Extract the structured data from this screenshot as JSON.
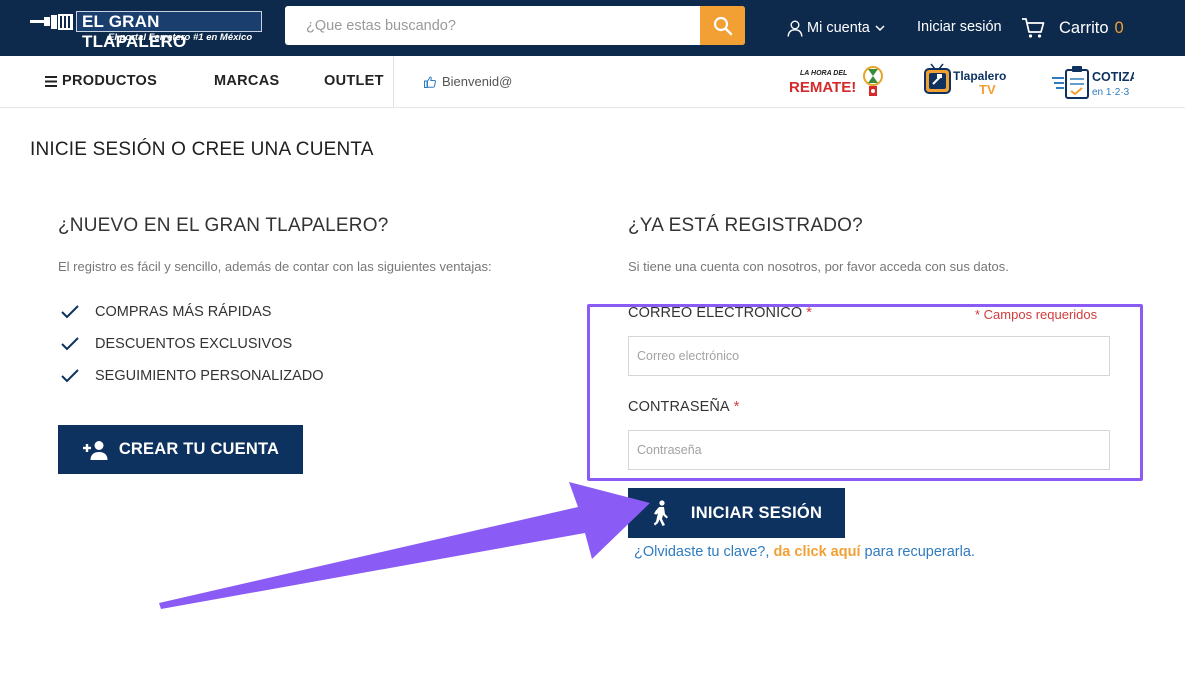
{
  "header": {
    "brand_name": "EL GRAN TLAPALERO",
    "brand_tagline": "El portal Ferretero #1 en México",
    "search_placeholder": "¿Que estas buscando?",
    "account_label": "Mi cuenta",
    "login_label": "Iniciar sesión",
    "cart_label": "Carrito",
    "cart_count": "0"
  },
  "nav": {
    "products_label": "PRODUCTOS",
    "brands_label": "MARCAS",
    "outlet_label": "OUTLET",
    "welcome_text": "Bienvenid@",
    "promo_logos": {
      "remate_top": "LA HORA DEL",
      "remate_main": "REMATE!",
      "tv_main": "Tlapalero",
      "tv_sub": "TV",
      "cotiza_main": "COTIZA",
      "cotiza_sub": "en 1·2·3"
    }
  },
  "page": {
    "title": "INICIE SESIÓN O CREE UNA CUENTA"
  },
  "register": {
    "title": "¿NUEVO EN EL GRAN TLAPALERO?",
    "subtitle": "El registro es fácil y sencillo, además de contar con las siguientes ventajas:",
    "benefits": [
      "COMPRAS MÁS RÁPIDAS",
      "DESCUENTOS EXCLUSIVOS",
      "SEGUIMIENTO PERSONALIZADO"
    ],
    "button_label": "CREAR TU CUENTA"
  },
  "login": {
    "title": "¿YA ESTÁ REGISTRADO?",
    "subtitle": "Si tiene una cuenta con nosotros, por favor acceda con sus datos.",
    "email_label": "CORREO ELECTRONICO",
    "required_star": "*",
    "required_note": "* Campos requeridos",
    "email_placeholder": "Correo electrónico",
    "password_label": "CONTRASEÑA",
    "password_placeholder": "Contraseña",
    "button_label": "INICIAR SESIÓN",
    "forgot_part1": "¿Olvidaste tu clave?,",
    "forgot_link": "da click aquí",
    "forgot_part2": "para recuperarla."
  },
  "colors": {
    "header_bg": "#0d2a4d",
    "accent_orange": "#f29f33",
    "button_blue": "#0e3260",
    "highlight_purple": "#8a5cf5",
    "link_blue": "#2f7bbf",
    "required_red": "#d23c3c"
  },
  "icons": {
    "search": "search-icon",
    "account": "user-icon",
    "cart": "cart-icon",
    "menu": "hamburger-icon",
    "welcome": "thumbs-up-icon",
    "check": "check-icon",
    "add_user": "add-user-icon",
    "walk": "walking-person-icon"
  }
}
